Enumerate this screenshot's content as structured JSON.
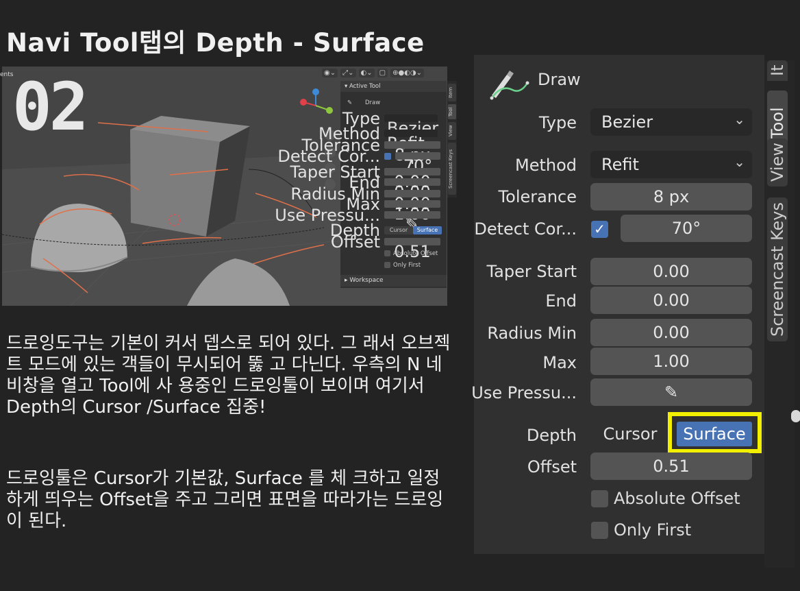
{
  "title": "Navi Tool탭의  Depth - Surface",
  "step_number": "02",
  "thumbnail": {
    "corner_label": "ents",
    "toolbar_icons": [
      "eye-icon",
      "gizmo-icon",
      "overlay-icon",
      "xray-icon",
      "shading-icon"
    ],
    "panel": {
      "header": "Active Tool",
      "tool_name": "Draw",
      "type_label": "Type",
      "type_value": "Bezier",
      "method_label": "Method",
      "method_value": "Refit",
      "tolerance_label": "Tolerance",
      "tolerance_value": "8 px",
      "detect_label": "Detect Cor...",
      "detect_value": "70°",
      "taper_start_label": "Taper Start",
      "taper_start_value": "0.00",
      "end_label": "End",
      "end_value": "0.00",
      "radius_min_label": "Radius Min",
      "radius_min_value": "0.00",
      "max_label": "Max",
      "max_value": "1.00",
      "use_pressure_label": "Use Pressu...",
      "depth_label": "Depth",
      "depth_cursor": "Cursor",
      "depth_surface": "Surface",
      "offset_label": "Offset",
      "offset_value": "0.51",
      "absolute_offset": "Absolute Offset",
      "only_first": "Only First",
      "workspace": "Workspace"
    },
    "tabs": [
      "Item",
      "Tool",
      "View",
      "Screencast Keys"
    ]
  },
  "paragraph1": "드로잉도구는 기본이 커서 뎁스로 되어 있다. 그 래서 오브젝트 모드에 있는 객들이 무시되어 뚫 고 다닌다. 우측의 N 네비창을 열고 Tool에 사 용중인 드로잉툴이 보이며 여기서 Depth의 Cursor /Surface 집중!",
  "paragraph2": "드로잉툴은 Cursor가 기본값, Surface 를 체 크하고 일정하게 띄우는 Offset을 주고 그리면 표면을 따라가는 드로잉이 된다.",
  "panel": {
    "tool_name": "Draw",
    "type_label": "Type",
    "type_value": "Bezier",
    "method_label": "Method",
    "method_value": "Refit",
    "tolerance_label": "Tolerance",
    "tolerance_value": "8 px",
    "detect_label": "Detect Cor...",
    "detect_value": "70°",
    "detect_checked": true,
    "taper_start_label": "Taper Start",
    "taper_start_value": "0.00",
    "end_label": "End",
    "end_value": "0.00",
    "radius_min_label": "Radius Min",
    "radius_min_value": "0.00",
    "max_label": "Max",
    "max_value": "1.00",
    "use_pressure_label": "Use Pressu...",
    "depth_label": "Depth",
    "depth_cursor": "Cursor",
    "depth_surface": "Surface",
    "offset_label": "Offset",
    "offset_value": "0.51",
    "absolute_offset_label": "Absolute Offset",
    "only_first_label": "Only First"
  },
  "side_tabs": {
    "item": "It",
    "tool": "Tool",
    "view": "View",
    "screencast": "Screencast Keys"
  },
  "colors": {
    "accent": "#4772b3",
    "highlight": "#f2f000",
    "background": "#232323",
    "panel": "#303030"
  }
}
